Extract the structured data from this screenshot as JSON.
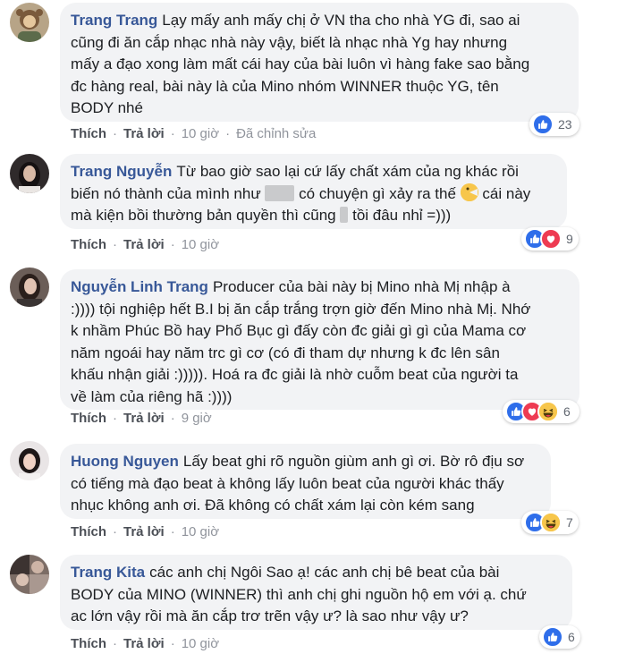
{
  "comments": [
    {
      "author": "Trang Trang",
      "lines": [
        "Lạy mấy anh mấy chị ở VN tha cho nhà YG đi, sao ai",
        "cũng đi ăn cắp nhạc nhà này vậy, biết là nhạc nhà Yg hay nhưng",
        "mấy a đạo xong làm mất cái hay của bài luôn vì hàng fake sao bằng",
        "đc hàng real, bài này là của Mino nhóm WINNER thuộc YG, tên",
        "BODY nhé"
      ],
      "like": "Thích",
      "reply": "Trả lời",
      "time": "10 giờ",
      "edited": "Đã chỉnh sửa",
      "reaction_count": "23"
    },
    {
      "author": "Trang Nguyễn",
      "line1": "Từ bao giờ sao lại cứ lấy chất xám của ng khác rồi",
      "line2a": "biến nó thành của mình như",
      "line2b": "có chuyện gì xảy ra thế",
      "line2c": "cái này",
      "line3a": "mà kiện bồi thường bản quyền thì cũng",
      "line3b": "tồi đâu nhỉ =)))",
      "like": "Thích",
      "reply": "Trả lời",
      "time": "10 giờ",
      "reaction_count": "9"
    },
    {
      "author": "Nguyễn Linh Trang",
      "lines": [
        "Producer của bài này bị Mino nhà Mị nhập à",
        ":)))) tội nghiệp hết B.I bị ăn cắp trắng trợn giờ đến Mino nhà Mị. Nhớ",
        "k nhầm Phúc Bồ hay Phố Bục gì đấy còn đc giải gì gì của Mama cơ",
        "năm ngoái hay năm trc gì cơ (có đi tham dự nhưng k đc lên sân",
        "khấu nhận giải :))))). Hoá ra đc giải là nhờ cuỗm beat của người ta",
        "về làm của riêng hã :))))"
      ],
      "like": "Thích",
      "reply": "Trả lời",
      "time": "9 giờ",
      "reaction_count": "6"
    },
    {
      "author": "Huong Nguyen",
      "lines": [
        "Lấy beat ghi rõ nguồn giùm anh gì ơi. Bờ rô địu sơ",
        "có tiếng mà đạo beat à không lấy luôn beat của người khác thấy",
        "nhục không anh ơi. Đã không có chất xám lại còn kém sang"
      ],
      "like": "Thích",
      "reply": "Trả lời",
      "time": "10 giờ",
      "reaction_count": "7"
    },
    {
      "author": "Trang Kita",
      "lines": [
        "các anh chị Ngôi Sao ạ! các anh chị bê beat của bài",
        "BODY của MINO (WINNER) thì anh chị ghi nguồn hộ em với ạ. chứ",
        "ac lớn vậy rồi mà ăn cắp trơ trẽn vậy ư? là sao như vậy ư?"
      ],
      "like": "Thích",
      "reply": "Trả lời",
      "time": "10 giờ",
      "reaction_count": "6"
    }
  ],
  "colors": {
    "author": "#385898",
    "bubble": "#f2f3f5",
    "like_reaction": "#2f6eea",
    "love_reaction": "#ee3b52",
    "haha_reaction": "#f7c64b"
  }
}
